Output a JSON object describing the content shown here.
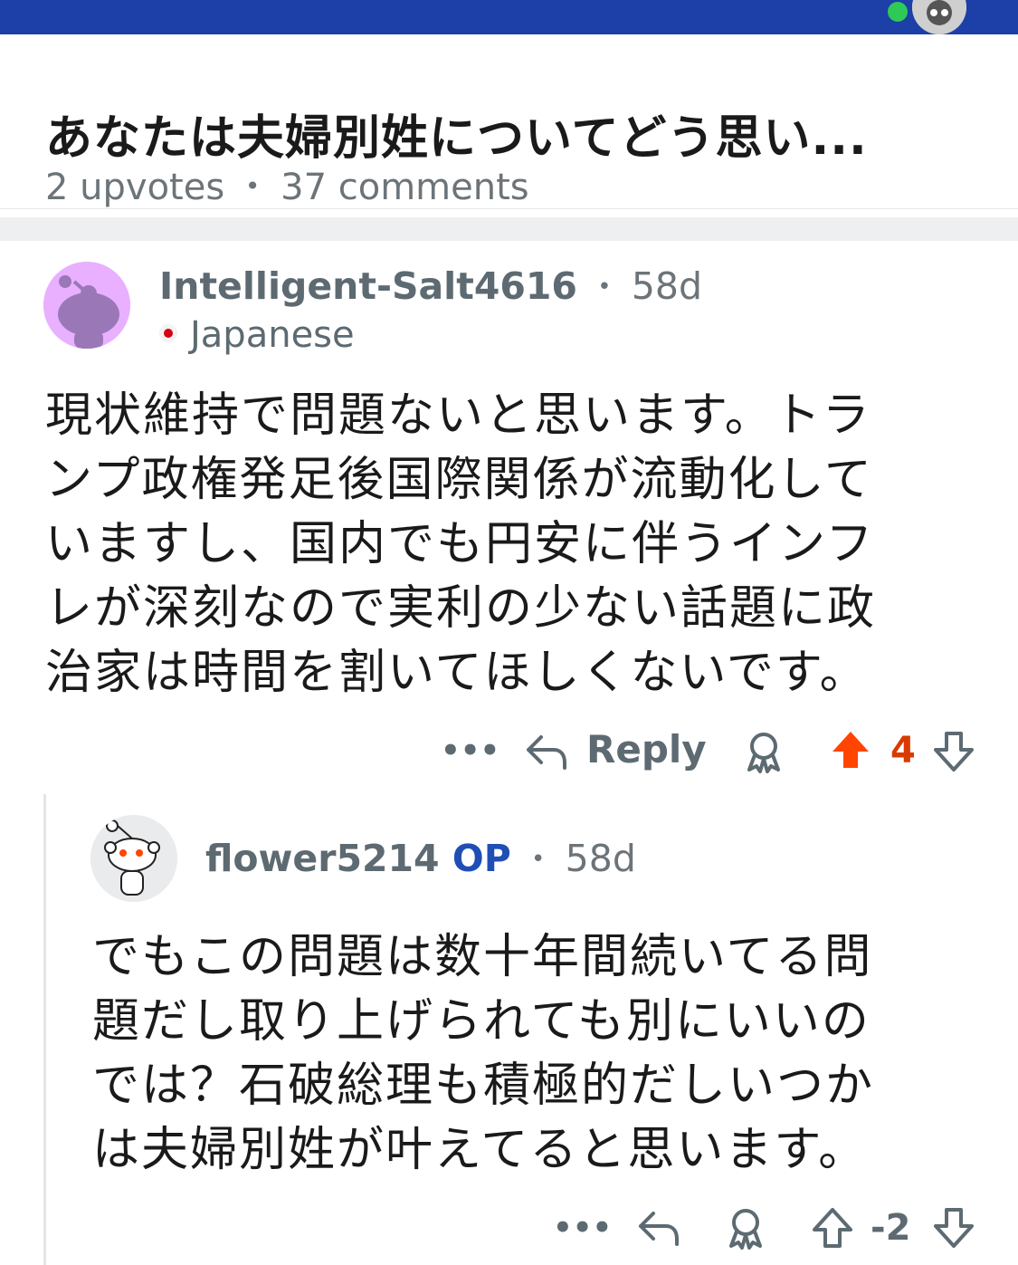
{
  "post": {
    "title": "あなたは夫婦別姓についてどう思い...",
    "upvotes": "2 upvotes",
    "meta_sep": "•",
    "comments": "37 comments"
  },
  "comments": [
    {
      "username": "Intelligent-Salt4616",
      "sep": "•",
      "age": "58d",
      "flair": "Japanese",
      "body_lines": [
        "現状維持で問題ないと思います。トラ",
        "ンプ政権発足後国際関係が流動化して",
        "いますし、国内でも円安に伴うインフ",
        "レが深刻なので実利の少ない話題に政",
        "治家は時間を割いてほしくないです。"
      ],
      "more": "•••",
      "reply_label": "Reply",
      "score": "4",
      "upvoted": true
    },
    {
      "username": "flower5214",
      "op_badge": "OP",
      "sep": "•",
      "age": "58d",
      "body_lines": [
        "でもこの問題は数十年間続いてる問",
        "題だし取り上げられても別にいいの",
        "では？石破総理も積極的だしいつか",
        "は夫婦別姓が叶えてると思います。"
      ],
      "more": "•••",
      "score": "-2",
      "upvoted": false
    }
  ],
  "colors": {
    "topbar": "#1c3fa8",
    "upvote_active": "#ff4500",
    "score_active": "#d93a00",
    "op": "#1f4fb5",
    "muted": "#5d6a72"
  }
}
